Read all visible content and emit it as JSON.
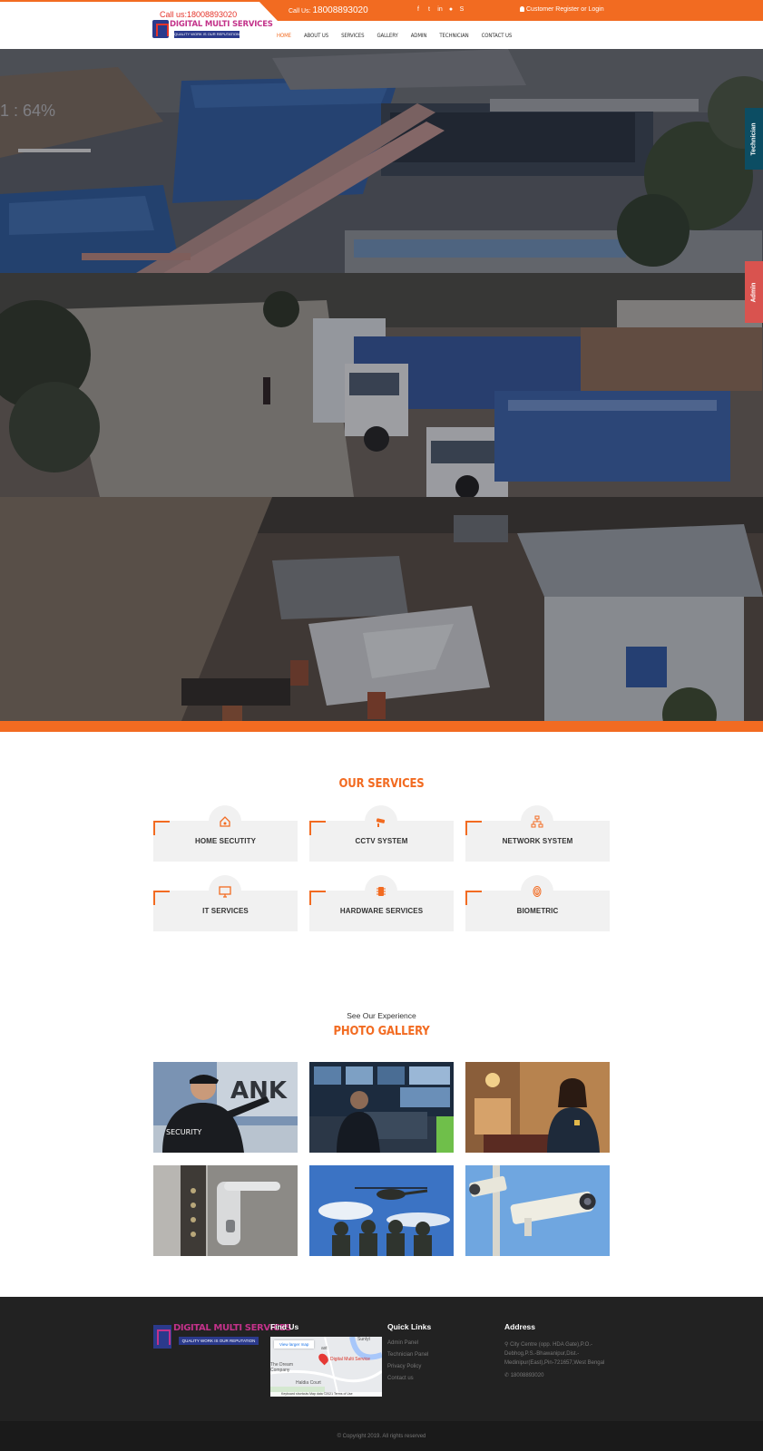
{
  "header": {
    "logo_call": "Call us:18008893020",
    "logo_name": "DIGITAL MULTI SERVICES",
    "logo_tagline": "QUALITY WORK IS OUR REPUTATION",
    "topbar_call_label": "Call Us:",
    "topbar_phone": "18008893020",
    "social_icons": [
      "facebook-icon",
      "twitter-icon",
      "linkedin-icon",
      "pinterest-icon",
      "skype-icon"
    ],
    "login_label": "Customer Register or Login",
    "nav": [
      "HOME",
      "ABOUT US",
      "SERVICES",
      "GALLERY",
      "ADMIN",
      "TECHNICIAN",
      "CONTACT US"
    ],
    "active_nav": "HOME"
  },
  "hero": {
    "overlay_text": "1 : 64%"
  },
  "side_tabs": {
    "technician": "Technician",
    "admin": "Admin"
  },
  "services": {
    "title": "OUR SERVICES",
    "items": [
      {
        "label": "HOME SECUTITY",
        "icon": "home-security-icon"
      },
      {
        "label": "CCTV SYSTEM",
        "icon": "cctv-camera-icon"
      },
      {
        "label": "NETWORK SYSTEM",
        "icon": "network-icon"
      },
      {
        "label": "IT SERVICES",
        "icon": "monitor-icon"
      },
      {
        "label": "HARDWARE SERVICES",
        "icon": "chip-icon"
      },
      {
        "label": "BIOMETRIC",
        "icon": "fingerprint-icon"
      }
    ]
  },
  "gallery": {
    "subtitle": "See Our Experience",
    "title": "PHOTO GALLERY"
  },
  "footer": {
    "logo_name": "DIGITAL MULTI SERVICES",
    "logo_tagline": "QUALITY WORK IS OUR REPUTATION",
    "find_us": "Find Us",
    "map": {
      "button": "View larger map",
      "place_main": "Digital Multi Service",
      "place_2": "The Dream Company",
      "place_3": "Haldia Court",
      "place_4": "Sunlyt",
      "place_5": "ast",
      "attribution": "Keyboard shortcuts   Map data ©2021   Terms of Use"
    },
    "quick_links_title": "Quick Links",
    "quick_links": [
      "Admin Panel",
      "Technician Panel",
      "Privacy Policy",
      "Contact us"
    ],
    "address_title": "Address",
    "address": "City Centre (opp. HDA Gate),P.O.-Debhog,P.S.-Bhawanipur,Dist.-Medinipur(East),Pin-721657,West Bengal",
    "phone": "18008893020",
    "copyright": "© Copyright 2019. All rights reserved"
  },
  "colors": {
    "accent": "#f26b21",
    "technician_tab": "#0c4d63",
    "admin_tab": "#d9534f",
    "footer_bg": "#222222"
  }
}
